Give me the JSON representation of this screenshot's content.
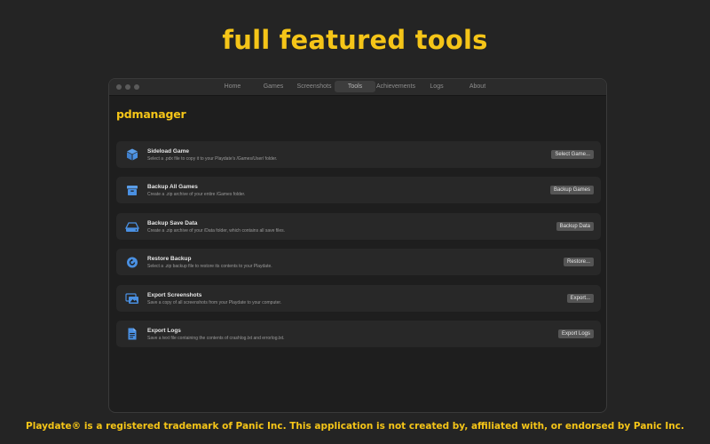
{
  "headline": "full featured tools",
  "footer": "Playdate® is a registered trademark of Panic Inc. This application is not created by, affiliated with, or endorsed by Panic Inc.",
  "window": {
    "tabs": [
      {
        "label": "Home"
      },
      {
        "label": "Games"
      },
      {
        "label": "Screenshots"
      },
      {
        "label": "Tools",
        "active": true
      },
      {
        "label": "Achievements"
      },
      {
        "label": "Logs"
      },
      {
        "label": "About"
      }
    ],
    "brand": "pdmanager"
  },
  "tools": [
    {
      "icon": "cube-icon",
      "title": "Sideload Game",
      "desc": "Select a .pdx file to copy it to your Playdate's /Games/User/ folder.",
      "button": "Select Game..."
    },
    {
      "icon": "archive-box-icon",
      "title": "Backup All Games",
      "desc": "Create a .zip archive of your entire /Games folder.",
      "button": "Backup Games"
    },
    {
      "icon": "drive-icon",
      "title": "Backup Save Data",
      "desc": "Create a .zip archive of your /Data folder, which contains all save files.",
      "button": "Backup Data"
    },
    {
      "icon": "restore-icon",
      "title": "Restore Backup",
      "desc": "Select a .zip backup file to restore its contents to your Playdate.",
      "button": "Restore..."
    },
    {
      "icon": "photos-icon",
      "title": "Export Screenshots",
      "desc": "Save a copy of all screenshots from your Playdate to your computer.",
      "button": "Export..."
    },
    {
      "icon": "document-icon",
      "title": "Export Logs",
      "desc": "Save a text file containing the contents of crashlog.txt and errorlog.txt.",
      "button": "Export Logs"
    }
  ],
  "colors": {
    "accent": "#f5c518",
    "icon": "#4a90e2"
  }
}
